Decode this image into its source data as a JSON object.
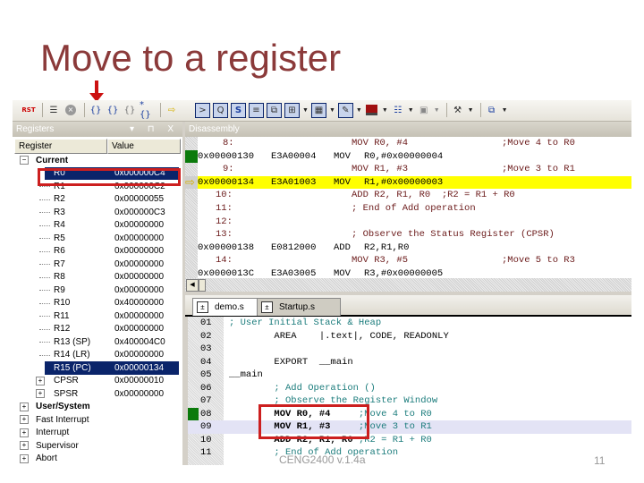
{
  "slide": {
    "title": "Move to a register",
    "footer": "CENG2400 v.1.4a",
    "page_number": "11",
    "accent_color": "#8b3a3a",
    "highlight_box_color": "#cc1f1f"
  },
  "toolbar": {
    "groups": [
      [
        "reset-cpu-icon",
        "sep",
        "trace-icon",
        "stop-icon",
        "sep",
        "step-into-icon",
        "step-over-icon",
        "step-out-icon",
        "run-to-cursor-icon",
        "sep",
        "show-next-statement-icon"
      ],
      [
        "command-window-icon",
        "disassembly-window-icon",
        "symbols-window-icon",
        "registers-window-icon",
        "call-stack-icon",
        "watch-window-icon",
        "memory-window-icon",
        "serial-window-icon",
        "logic-analyzer-icon",
        "performance-analyzer-icon",
        "system-viewer-icon",
        "toolbox-icon",
        "window-layout-icon"
      ]
    ],
    "reset_label": "RST"
  },
  "registers": {
    "title": "Registers",
    "controls": "▾ ⊓ X",
    "columns": [
      "Register",
      "Value"
    ],
    "root": "Current",
    "rows": [
      {
        "name": "R0",
        "value": "0x000000C4",
        "selected": true
      },
      {
        "name": "R1",
        "value": "0x000000C2"
      },
      {
        "name": "R2",
        "value": "0x00000055"
      },
      {
        "name": "R3",
        "value": "0x000000C3"
      },
      {
        "name": "R4",
        "value": "0x00000000"
      },
      {
        "name": "R5",
        "value": "0x00000000"
      },
      {
        "name": "R6",
        "value": "0x00000000"
      },
      {
        "name": "R7",
        "value": "0x00000000"
      },
      {
        "name": "R8",
        "value": "0x00000000"
      },
      {
        "name": "R9",
        "value": "0x00000000"
      },
      {
        "name": "R10",
        "value": "0x40000000"
      },
      {
        "name": "R11",
        "value": "0x00000000"
      },
      {
        "name": "R12",
        "value": "0x00000000"
      },
      {
        "name": "R13 (SP)",
        "value": "0x400004C0"
      },
      {
        "name": "R14 (LR)",
        "value": "0x00000000"
      },
      {
        "name": "R15 (PC)",
        "value": "0x00000134",
        "selected": true
      },
      {
        "name": "CPSR",
        "value": "0x00000010",
        "expandable": true
      },
      {
        "name": "SPSR",
        "value": "0x00000000",
        "expandable": true
      }
    ],
    "groups": [
      "User/System",
      "Fast Interrupt",
      "Interrupt",
      "Supervisor",
      "Abort"
    ]
  },
  "disassembly": {
    "title": "Disassembly",
    "lines": [
      {
        "type": "src",
        "label": "8:",
        "text": "MOV R0, #4",
        "comment": ";Move 4 to R0"
      },
      {
        "type": "asm",
        "addr": "0x00000130",
        "op": "E3A00004",
        "mn": "MOV",
        "args": "R0,#0x00000004",
        "marker": "green"
      },
      {
        "type": "src",
        "label": "9:",
        "text": "MOV R1, #3",
        "comment": ";Move 3 to R1"
      },
      {
        "type": "asm",
        "addr": "0x00000134",
        "op": "E3A01003",
        "mn": "MOV",
        "args": "R1,#0x00000003",
        "marker": "arrow",
        "current": true
      },
      {
        "type": "src",
        "label": "10:",
        "text": "ADD R2, R1, R0  ;R2 = R1 + R0",
        "comment": ""
      },
      {
        "type": "src",
        "label": "11:",
        "text": "; End of Add operation",
        "comment": ""
      },
      {
        "type": "src",
        "label": "12:",
        "text": "",
        "comment": ""
      },
      {
        "type": "src",
        "label": "13:",
        "text": "; Observe the Status Register (CPSR)",
        "comment": ""
      },
      {
        "type": "asm",
        "addr": "0x00000138",
        "op": "E0812000",
        "mn": "ADD",
        "args": "R2,R1,R0"
      },
      {
        "type": "src",
        "label": "14:",
        "text": "MOV R3, #5",
        "comment": ";Move 5 to R3"
      },
      {
        "type": "asm",
        "addr": "0x0000013C",
        "op": "E3A03005",
        "mn": "MOV",
        "args": "R3,#0x00000005"
      }
    ]
  },
  "editor": {
    "tabs": [
      {
        "label": "demo.s",
        "active": true
      },
      {
        "label": "Startup.s",
        "active": false
      }
    ],
    "lines": [
      {
        "ln": "01",
        "code": "; User Initial Stack & Heap",
        "style": "cmt"
      },
      {
        "ln": "02",
        "code": "        AREA    |.text|, CODE, READONLY",
        "style": ""
      },
      {
        "ln": "03",
        "code": "",
        "style": ""
      },
      {
        "ln": "04",
        "code": "        EXPORT  __main",
        "style": ""
      },
      {
        "ln": "05",
        "code": "__main",
        "style": ""
      },
      {
        "ln": "06",
        "code": "        ; Add Operation ()",
        "style": "cmt"
      },
      {
        "ln": "07",
        "code": "        ; Observe the Register Window",
        "style": "cmt"
      },
      {
        "ln": "08",
        "code": "        MOV R0, #4",
        "comment": "     ;Move 4 to R0",
        "style": "kw",
        "marker": "green"
      },
      {
        "ln": "09",
        "code": "        MOV R1, #3",
        "comment": "     ;Move 3 to R1",
        "style": "kw",
        "marker": "arrow",
        "current": true
      },
      {
        "ln": "10",
        "code": "        ADD R2, R1, R0",
        "comment": " ;R2 = R1 + R0",
        "style": "kw"
      },
      {
        "ln": "11",
        "code": "        ; End of Add operation",
        "style": "cmt"
      }
    ]
  }
}
